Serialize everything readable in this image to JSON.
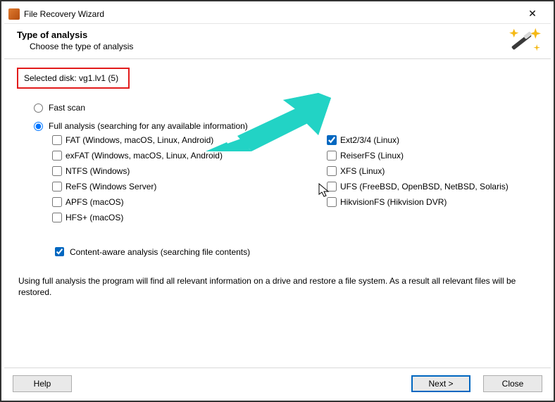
{
  "window": {
    "title": "File Recovery Wizard"
  },
  "header": {
    "title": "Type of analysis",
    "subtitle": "Choose the type of analysis"
  },
  "selected_disk": {
    "label": "Selected disk: vg1.lv1 (5)"
  },
  "scan": {
    "fast_label": "Fast scan",
    "full_label": "Full analysis (searching for any available information)",
    "selected": "full"
  },
  "fs_left": [
    {
      "label": "FAT (Windows, macOS, Linux, Android)",
      "checked": false
    },
    {
      "label": "exFAT (Windows, macOS, Linux, Android)",
      "checked": false
    },
    {
      "label": "NTFS (Windows)",
      "checked": false
    },
    {
      "label": "ReFS (Windows Server)",
      "checked": false
    },
    {
      "label": "APFS (macOS)",
      "checked": false
    },
    {
      "label": "HFS+ (macOS)",
      "checked": false
    }
  ],
  "fs_right": [
    {
      "label": "Ext2/3/4 (Linux)",
      "checked": true
    },
    {
      "label": "ReiserFS (Linux)",
      "checked": false
    },
    {
      "label": "XFS (Linux)",
      "checked": false
    },
    {
      "label": "UFS (FreeBSD, OpenBSD, NetBSD, Solaris)",
      "checked": false
    },
    {
      "label": "HikvisionFS (Hikvision DVR)",
      "checked": false
    }
  ],
  "content_aware": {
    "label": "Content-aware analysis (searching file contents)",
    "checked": true
  },
  "explain": "Using full analysis the program will find all relevant information on a drive and restore a file system. As a result all relevant files will be restored.",
  "buttons": {
    "help": "Help",
    "next": "Next >",
    "close": "Close"
  },
  "annotation": {
    "arrow_color": "#22d3c5",
    "highlight_color": "#e21b1b"
  }
}
